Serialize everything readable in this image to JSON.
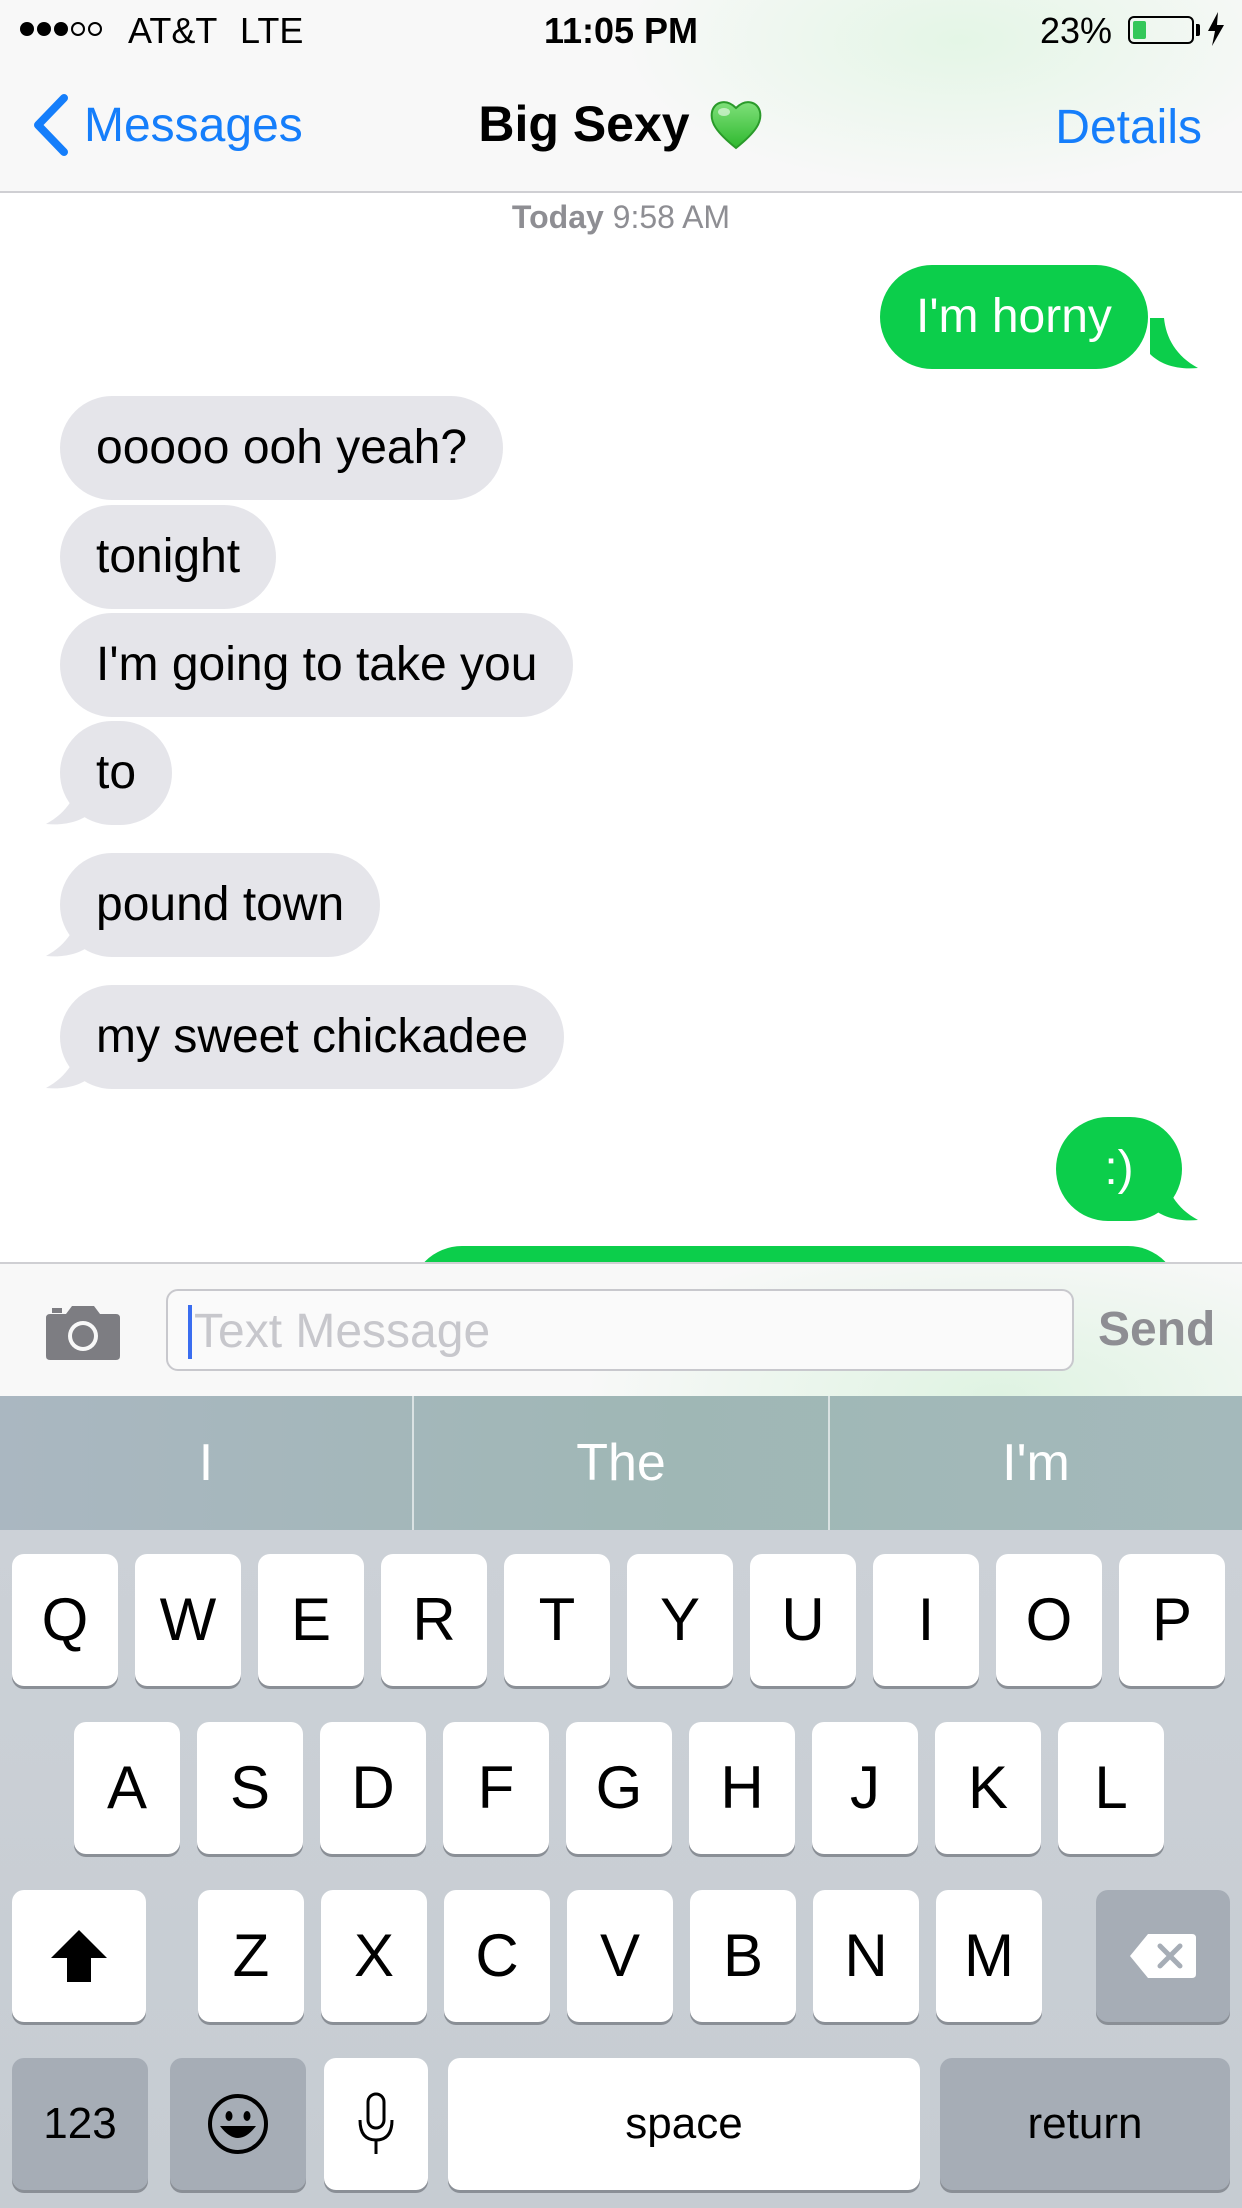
{
  "status_bar": {
    "carrier": "AT&T",
    "network": "LTE",
    "time": "11:05 PM",
    "battery_percent_label": "23%",
    "battery_level": 0.23,
    "signal_bars": 3,
    "signal_max": 5
  },
  "nav": {
    "back_label": "Messages",
    "title": "Big Sexy",
    "title_emoji": "💚",
    "details_label": "Details"
  },
  "conversation": {
    "timestamp_day": "Today",
    "timestamp_time": "9:58 AM",
    "messages": [
      {
        "from": "me",
        "text": "I'm horny"
      },
      {
        "from": "them",
        "text": "ooooo ooh yeah?"
      },
      {
        "from": "them",
        "text": "tonight"
      },
      {
        "from": "them",
        "text": "I'm going to take you"
      },
      {
        "from": "them",
        "text": "to"
      },
      {
        "from": "them",
        "text": "pound town"
      },
      {
        "from": "them",
        "text": "my sweet chickadee"
      },
      {
        "from": "me",
        "text": ":)"
      }
    ]
  },
  "input_bar": {
    "placeholder": "Text Message",
    "send_label": "Send"
  },
  "keyboard": {
    "predictions": [
      "I",
      "The",
      "I'm"
    ],
    "row1": [
      "Q",
      "W",
      "E",
      "R",
      "T",
      "Y",
      "U",
      "I",
      "O",
      "P"
    ],
    "row2": [
      "A",
      "S",
      "D",
      "F",
      "G",
      "H",
      "J",
      "K",
      "L"
    ],
    "row3": [
      "Z",
      "X",
      "C",
      "V",
      "B",
      "N",
      "M"
    ],
    "numbers_label": "123",
    "space_label": "space",
    "return_label": "return"
  },
  "colors": {
    "ios_blue": "#157efb",
    "sent_bubble": "#0cce4b",
    "received_bubble": "#e5e5ea",
    "keyboard_bg": "#cdd2d8"
  },
  "icons": [
    "chevron-left-icon",
    "green-heart-emoji",
    "camera-icon",
    "shift-icon",
    "backspace-icon",
    "emoji-icon",
    "microphone-icon",
    "charging-bolt-icon"
  ]
}
